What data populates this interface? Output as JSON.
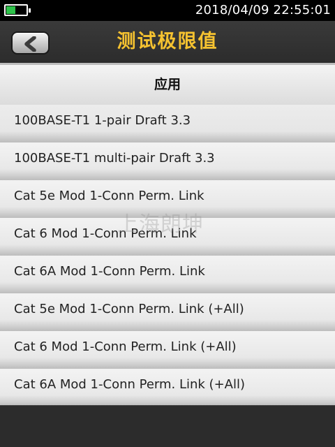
{
  "status_bar": {
    "datetime": "2018/04/09  22:55:01",
    "battery_level": 0.45,
    "battery_color": "#2ec24a"
  },
  "header": {
    "title": "测试极限值",
    "back_icon": "chevron-left-icon",
    "title_color": "#f5c230"
  },
  "section": {
    "title": "应用"
  },
  "list": {
    "items": [
      "100BASE-T1 1-pair Draft 3.3",
      "100BASE-T1 multi-pair Draft 3.3",
      "Cat 5e Mod 1-Conn Perm. Link",
      "Cat 6 Mod 1-Conn Perm. Link",
      "Cat 6A Mod 1-Conn Perm. Link",
      "Cat 5e Mod 1-Conn Perm. Link (+All)",
      "Cat 6 Mod 1-Conn Perm. Link (+All)",
      "Cat 6A Mod 1-Conn Perm. Link (+All)"
    ]
  },
  "watermark": "上海朗坤"
}
